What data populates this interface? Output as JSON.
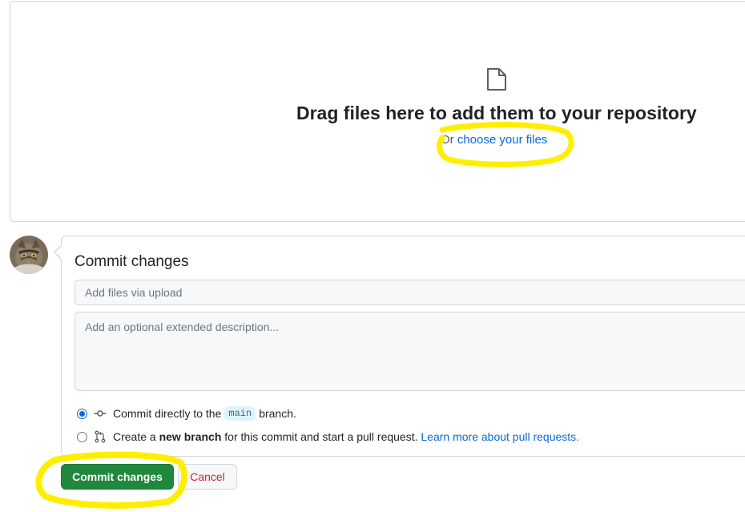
{
  "upload": {
    "drop_title": "Drag files here to add them to your repository",
    "or_text": "Or",
    "choose_link": "choose your files"
  },
  "commit": {
    "title": "Commit changes",
    "summary_placeholder": "Add files via upload",
    "description_placeholder": "Add an optional extended description...",
    "option_direct": {
      "prefix": "Commit directly to the",
      "branch": "main",
      "suffix": "branch.",
      "selected": true
    },
    "option_new_branch": {
      "prefix": "Create a",
      "bold": "new branch",
      "suffix": "for this commit and start a pull request.",
      "link": "Learn more about pull requests.",
      "selected": false
    },
    "submit_label": "Commit changes",
    "cancel_label": "Cancel"
  },
  "colors": {
    "accent": "#0969da",
    "primary_button": "#1f883d",
    "danger": "#cf222e",
    "highlight": "#ffee00"
  },
  "icons": [
    "file-icon",
    "git-commit-icon",
    "git-pull-request-icon",
    "avatar"
  ]
}
